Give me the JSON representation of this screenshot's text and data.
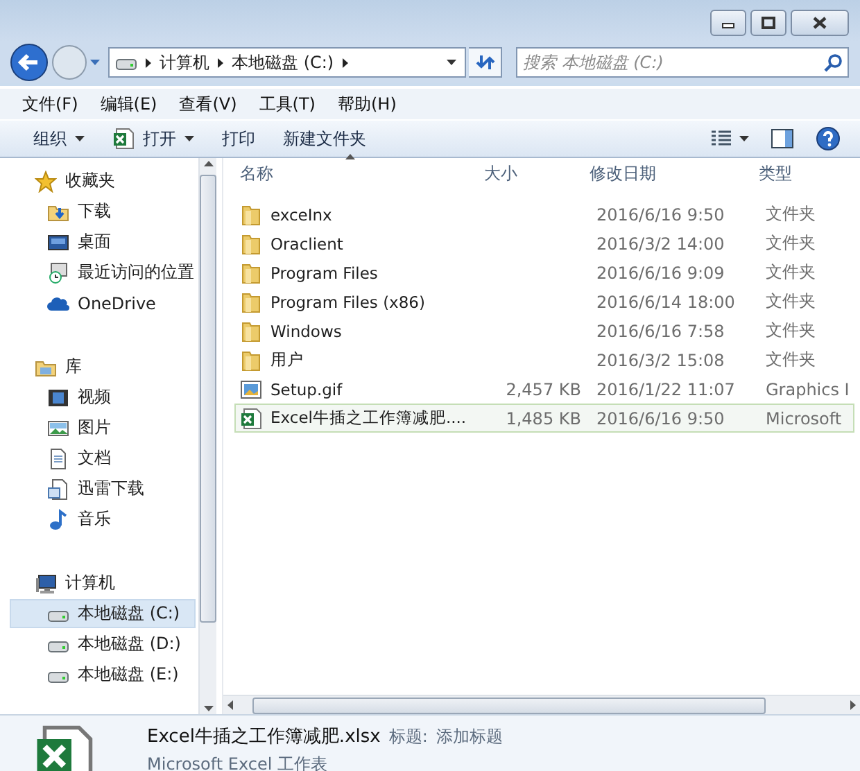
{
  "address": {
    "crumbs": [
      "计算机",
      "本地磁盘 (C:)"
    ]
  },
  "search": {
    "placeholder": "搜索 本地磁盘 (C:)"
  },
  "menu": [
    "文件(F)",
    "编辑(E)",
    "查看(V)",
    "工具(T)",
    "帮助(H)"
  ],
  "toolbar": [
    {
      "label": "组织",
      "kind": "menu"
    },
    {
      "label": "打开",
      "kind": "app-menu"
    },
    {
      "label": "打印",
      "kind": "plain"
    },
    {
      "label": "新建文件夹",
      "kind": "plain"
    }
  ],
  "sidebar": {
    "groups": [
      {
        "label": "收藏夹",
        "kind": "star",
        "selected": false,
        "children": [
          {
            "label": "下载",
            "kind": "download",
            "selected": false
          },
          {
            "label": "桌面",
            "kind": "desktop",
            "selected": false
          },
          {
            "label": "最近访问的位置",
            "kind": "recent",
            "selected": false
          },
          {
            "label": "OneDrive",
            "kind": "cloud",
            "selected": false
          }
        ]
      },
      {
        "label": "库",
        "kind": "library",
        "selected": false,
        "children": [
          {
            "label": "视频",
            "kind": "video",
            "selected": false
          },
          {
            "label": "图片",
            "kind": "picture",
            "selected": false
          },
          {
            "label": "文档",
            "kind": "document",
            "selected": false
          },
          {
            "label": "迅雷下载",
            "kind": "docfolder",
            "selected": false
          },
          {
            "label": "音乐",
            "kind": "music",
            "selected": false
          }
        ]
      },
      {
        "label": "计算机",
        "kind": "computer",
        "selected": false,
        "children": [
          {
            "label": "本地磁盘 (C:)",
            "kind": "drive",
            "selected": true
          },
          {
            "label": "本地磁盘 (D:)",
            "kind": "drive",
            "selected": false
          },
          {
            "label": "本地磁盘 (E:)",
            "kind": "drive",
            "selected": false
          }
        ]
      }
    ]
  },
  "files": {
    "columns": [
      {
        "label": "名称",
        "sorted": true
      },
      {
        "label": "大小",
        "sorted": false
      },
      {
        "label": "修改日期",
        "sorted": false
      },
      {
        "label": "类型",
        "sorted": false
      }
    ],
    "rows": [
      {
        "name": "exceInx",
        "size": "",
        "date": "2016/6/16 9:50",
        "type": "文件夹",
        "kind": "folder",
        "selected": false
      },
      {
        "name": "Oraclient",
        "size": "",
        "date": "2016/3/2 14:00",
        "type": "文件夹",
        "kind": "folder",
        "selected": false
      },
      {
        "name": "Program Files",
        "size": "",
        "date": "2016/6/16 9:09",
        "type": "文件夹",
        "kind": "folder",
        "selected": false
      },
      {
        "name": "Program Files (x86)",
        "size": "",
        "date": "2016/6/14 18:00",
        "type": "文件夹",
        "kind": "folder",
        "selected": false
      },
      {
        "name": "Windows",
        "size": "",
        "date": "2016/6/16 7:58",
        "type": "文件夹",
        "kind": "folder",
        "selected": false
      },
      {
        "name": "用户",
        "size": "",
        "date": "2016/3/2 15:08",
        "type": "文件夹",
        "kind": "folder",
        "selected": false
      },
      {
        "name": "Setup.gif",
        "size": "2,457 KB",
        "date": "2016/1/22 11:07",
        "type": "Graphics I",
        "kind": "image",
        "selected": false
      },
      {
        "name": "Excel牛插之工作簿减肥....",
        "size": "1,485 KB",
        "date": "2016/6/16 9:50",
        "type": "Microsoft",
        "kind": "excel",
        "selected": true
      }
    ]
  },
  "details": {
    "filename": "Excel牛插之工作簿减肥.xlsx",
    "title_label": "标题:",
    "title_value": "添加标题",
    "file_type": "Microsoft Excel 工作表"
  }
}
